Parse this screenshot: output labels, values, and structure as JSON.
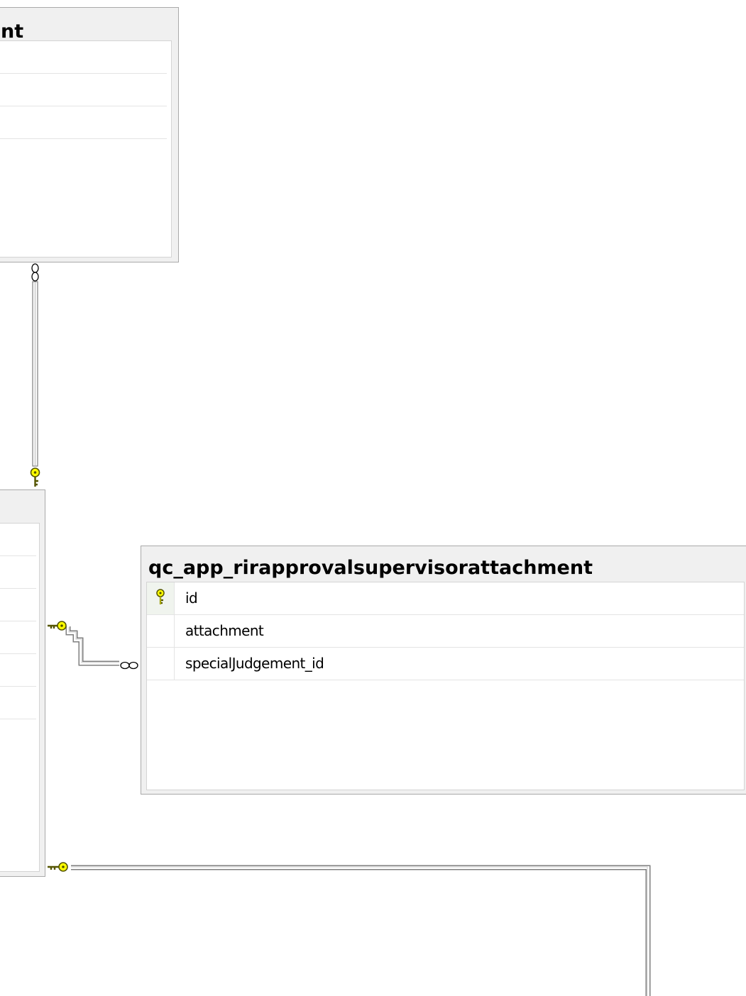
{
  "tables": {
    "top_table": {
      "title_fragment": "nt",
      "columns": [
        "",
        "",
        ""
      ]
    },
    "middle_table": {
      "columns": [
        "",
        "",
        "",
        "",
        "",
        ""
      ]
    },
    "attachment_table": {
      "title": "qc_app_rirapprovalsupervisorattachment",
      "columns": [
        {
          "name": "id",
          "primary_key": true
        },
        {
          "name": "attachment",
          "primary_key": false
        },
        {
          "name": "specialJudgement_id",
          "primary_key": false
        }
      ]
    }
  },
  "relationships": [
    {
      "from": "top_table",
      "to": "middle_table",
      "one_end": "middle_table",
      "many_end": "top_table"
    },
    {
      "from": "middle_table",
      "to": "attachment_table",
      "one_end": "middle_table",
      "many_end": "attachment_table"
    },
    {
      "from": "middle_table",
      "to": "offscreen_table",
      "one_end": "middle_table",
      "many_end": "offscreen"
    }
  ],
  "colors": {
    "key_fill": "#ffff00",
    "key_stroke": "#555500",
    "connector_line": "#7f7f7f",
    "table_frame": "#f0f0f0",
    "table_border": "#a9a9a9"
  }
}
